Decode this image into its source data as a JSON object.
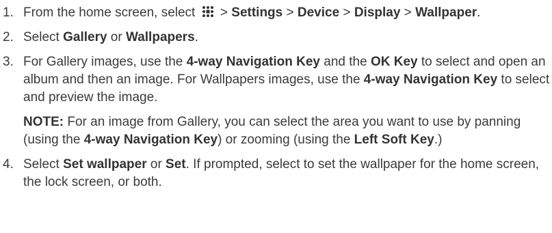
{
  "steps": [
    {
      "num": "1.",
      "t1": "From the home screen, select ",
      "icon": "apps-grid-icon",
      "t2": " > ",
      "b1": "Settings",
      "t3": " > ",
      "b2": "Device",
      "t4": " > ",
      "b3": "Display",
      "t5": " > ",
      "b4": "Wallpaper",
      "t6": "."
    },
    {
      "num": "2.",
      "t1": "Select ",
      "b1": "Gallery",
      "t2": " or ",
      "b2": "Wallpapers",
      "t3": "."
    },
    {
      "num": "3.",
      "t1": "For Gallery images, use the ",
      "b1": "4-way Navigation Key",
      "t2": " and the ",
      "b2": "OK Key",
      "t3": " to select and open an album and then an image. For Wallpapers images, use the ",
      "b3": "4-way Navigation Key",
      "t4": " to select and preview the image.",
      "note": {
        "label": "NOTE:",
        "t1": " For an image from Gallery, you can select the area you want to use by panning (using the ",
        "b1": "4-way Navigation Key",
        "t2": ") or zooming (using the ",
        "b2": "Left Soft Key",
        "t3": ".)"
      }
    },
    {
      "num": "4.",
      "t1": "Select ",
      "b1": "Set wallpaper",
      "t2": " or ",
      "b2": "Set",
      "t3": ". If prompted, select to set the wallpaper for the home screen, the lock screen, or both."
    }
  ]
}
